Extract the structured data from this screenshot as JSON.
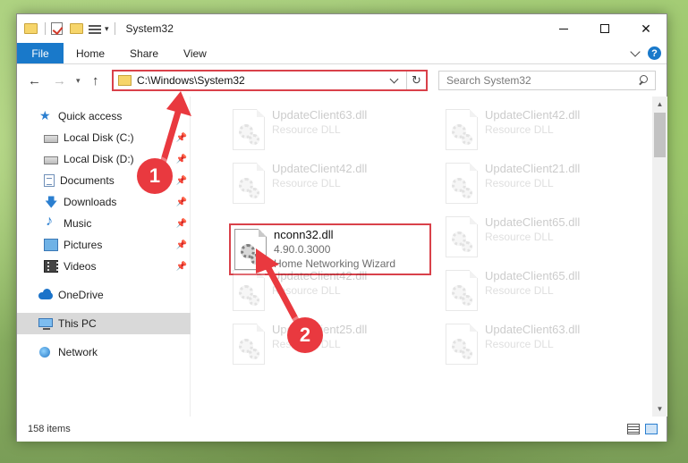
{
  "window": {
    "title": "System32",
    "controls": {
      "minimize": "—",
      "maximize": "☐",
      "close": "✕"
    }
  },
  "ribbon": {
    "file": "File",
    "tabs": [
      "Home",
      "Share",
      "View"
    ],
    "help": "?"
  },
  "address": {
    "path": "C:\\Windows\\System32",
    "refresh": "↻"
  },
  "search": {
    "placeholder": "Search System32"
  },
  "nav": {
    "back": "←",
    "forward": "→",
    "recent": "▾",
    "up": "↑"
  },
  "sidebar": {
    "items": [
      {
        "label": "Quick access",
        "icon": "star-icon",
        "pinned": false
      },
      {
        "label": "Local Disk (C:)",
        "icon": "drive-icon",
        "pinned": true
      },
      {
        "label": "Local Disk (D:)",
        "icon": "drive-icon",
        "pinned": true
      },
      {
        "label": "Documents",
        "icon": "documents-icon",
        "pinned": true
      },
      {
        "label": "Downloads",
        "icon": "downloads-icon",
        "pinned": true
      },
      {
        "label": "Music",
        "icon": "music-icon",
        "pinned": true
      },
      {
        "label": "Pictures",
        "icon": "pictures-icon",
        "pinned": true
      },
      {
        "label": "Videos",
        "icon": "videos-icon",
        "pinned": true
      },
      {
        "label": "OneDrive",
        "icon": "onedrive-icon",
        "pinned": false
      },
      {
        "label": "This PC",
        "icon": "computer-icon",
        "pinned": false,
        "selected": true
      },
      {
        "label": "Network",
        "icon": "network-icon",
        "pinned": false
      }
    ],
    "pin_glyph": "📌"
  },
  "files": [
    {
      "name": "UpdateClient63.dll",
      "sub1": "Resource DLL",
      "sub2": "",
      "faded": true
    },
    {
      "name": "UpdateClient42.dll",
      "sub1": "Resource DLL",
      "sub2": "",
      "faded": true
    },
    {
      "name": "UpdateClient42.dll",
      "sub1": "Resource DLL",
      "sub2": "",
      "faded": true
    },
    {
      "name": "UpdateClient21.dll",
      "sub1": "Resource DLL",
      "sub2": "",
      "faded": true
    },
    {
      "name": "nconn32.dll",
      "sub1": "4.90.0.3000",
      "sub2": "Home Networking Wizard",
      "faded": false
    },
    {
      "name": "UpdateClient65.dll",
      "sub1": "Resource DLL",
      "sub2": "",
      "faded": true
    },
    {
      "name": "UpdateClient42.dll",
      "sub1": "Resource DLL",
      "sub2": "",
      "faded": true
    },
    {
      "name": "UpdateClient65.dll",
      "sub1": "Resource DLL",
      "sub2": "",
      "faded": true
    },
    {
      "name": "UpdateClient25.dll",
      "sub1": "Resource DLL",
      "sub2": "",
      "faded": true
    },
    {
      "name": "UpdateClient63.dll",
      "sub1": "Resource DLL",
      "sub2": "",
      "faded": true
    }
  ],
  "status": {
    "item_count": "158 items"
  },
  "annotations": {
    "step1": "1",
    "step2": "2"
  },
  "colors": {
    "accent": "#1979ca",
    "highlight": "#d9414a",
    "callout": "#e9393f"
  }
}
